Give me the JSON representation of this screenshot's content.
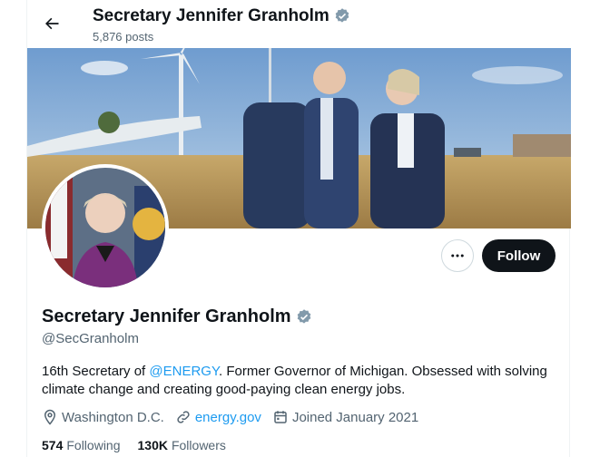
{
  "header": {
    "name": "Secretary Jennifer Granholm",
    "posts": "5,876 posts"
  },
  "profile": {
    "display_name": "Secretary Jennifer Granholm",
    "handle": "@SecGranholm",
    "bio_prefix": "16th Secretary of ",
    "bio_mention": "@ENERGY",
    "bio_suffix": ". Former Governor of Michigan. Obsessed with solving climate change and creating good-paying clean energy jobs.",
    "location": "Washington D.C.",
    "website": "energy.gov",
    "joined": "Joined January 2021"
  },
  "actions": {
    "follow_label": "Follow"
  },
  "stats": {
    "following_count": "574",
    "following_label": "Following",
    "followers_count": "130K",
    "followers_label": "Followers"
  },
  "colors": {
    "accent": "#1d9bf0",
    "verified": "#829aab",
    "follow_button": "#0f1419"
  },
  "icons": [
    "back-arrow-icon",
    "verified-badge-icon",
    "more-icon",
    "location-icon",
    "link-icon",
    "calendar-icon"
  ]
}
